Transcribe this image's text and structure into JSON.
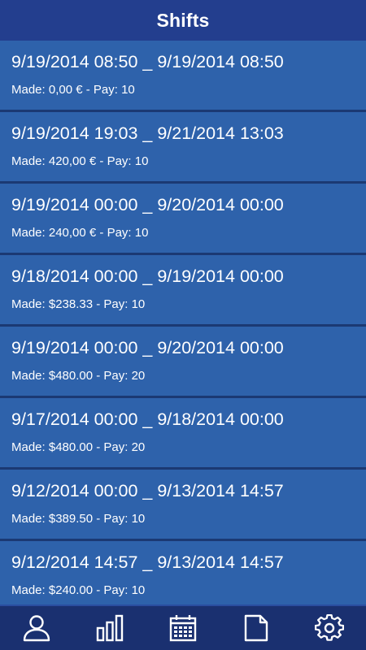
{
  "header": {
    "title": "Shifts"
  },
  "shifts": [
    {
      "range": "9/19/2014 08:50 _ 9/19/2014 08:50",
      "made": "Made: 0,00 € - Pay: 10"
    },
    {
      "range": "9/19/2014 19:03 _ 9/21/2014 13:03",
      "made": "Made: 420,00 € - Pay: 10"
    },
    {
      "range": "9/19/2014 00:00 _ 9/20/2014 00:00",
      "made": "Made: 240,00 € - Pay: 10"
    },
    {
      "range": "9/18/2014 00:00 _ 9/19/2014 00:00",
      "made": "Made: $238.33 - Pay: 10"
    },
    {
      "range": "9/19/2014 00:00 _ 9/20/2014 00:00",
      "made": "Made: $480.00 - Pay: 20"
    },
    {
      "range": "9/17/2014 00:00 _ 9/18/2014 00:00",
      "made": "Made: $480.00 - Pay: 20"
    },
    {
      "range": "9/12/2014 00:00 _ 9/13/2014 14:57",
      "made": "Made: $389.50 - Pay: 10"
    },
    {
      "range": "9/12/2014 14:57 _ 9/13/2014 14:57",
      "made": "Made: $240.00 - Pay: 10"
    }
  ],
  "tabbar": {
    "items": [
      {
        "icon": "user-icon"
      },
      {
        "icon": "bar-chart-icon"
      },
      {
        "icon": "calendar-icon"
      },
      {
        "icon": "document-icon"
      },
      {
        "icon": "gear-icon"
      }
    ]
  },
  "colors": {
    "header_bg": "#233e8e",
    "item_bg": "#2e62ab",
    "tabbar_bg": "#1a3070",
    "text": "#ffffff"
  }
}
